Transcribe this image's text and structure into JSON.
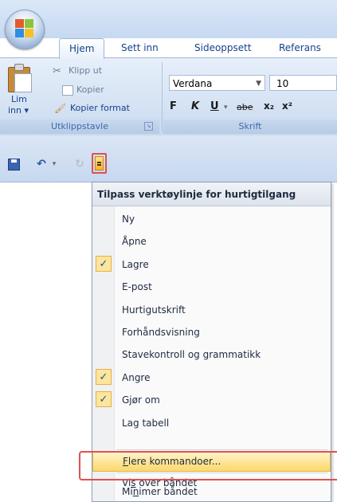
{
  "ribbon": {
    "tabs": [
      "Hjem",
      "Sett inn",
      "Sideoppsett",
      "Referans"
    ],
    "clipboard": {
      "cut": "Klipp ut",
      "copy": "Kopier",
      "paste_line1": "Lim",
      "paste_line2": "inn",
      "format_painter": "Kopier format",
      "group_label": "Utklippstavle"
    },
    "font": {
      "font_name": "Verdana",
      "font_size": "10",
      "group_label": "Skrift",
      "buttons": [
        "F",
        "K",
        "U",
        "abe",
        "x₂",
        "x²"
      ]
    }
  },
  "quick_access": {
    "icons": [
      "save-icon",
      "undo-icon",
      "redo-icon",
      "customize-dropdown-icon"
    ]
  },
  "menu": {
    "title": "Tilpass verktøylinje for hurtigtilgang",
    "items": [
      {
        "label": "Ny",
        "checked": false
      },
      {
        "label": "Åpne",
        "checked": false
      },
      {
        "label": "Lagre",
        "checked": true
      },
      {
        "label": "E-post",
        "checked": false
      },
      {
        "label": "Hurtigutskrift",
        "checked": false
      },
      {
        "label": "Forhåndsvisning",
        "checked": false
      },
      {
        "label": "Stavekontroll og grammatikk",
        "checked": false
      },
      {
        "label": "Angre",
        "checked": true
      },
      {
        "label": "Gjør om",
        "checked": true
      },
      {
        "label": "Lag tabell",
        "checked": false
      }
    ],
    "more_commands": {
      "pre": "",
      "u": "F",
      "post": "lere kommandoer..."
    },
    "show_below": {
      "pre": "Vi",
      "u": "s",
      "post": " over båndet"
    },
    "minimize": {
      "pre": "Mi",
      "u": "n",
      "post": "imer båndet"
    },
    "check_mark": "✓"
  },
  "colors": {
    "accent_highlight": "#fcd86a",
    "annotation_red": "#e05050"
  }
}
